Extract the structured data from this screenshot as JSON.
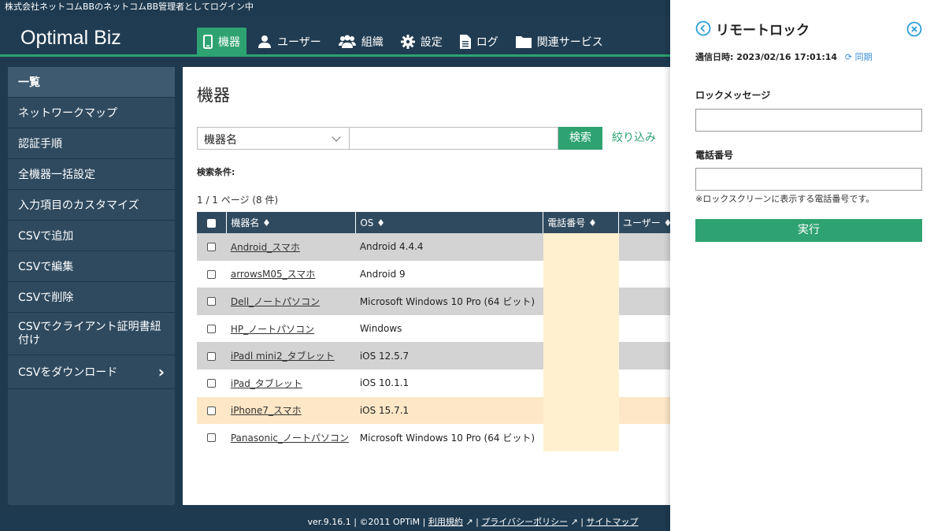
{
  "topbar": {
    "login_text": "株式会社ネットコムBBのネットコムBB管理者としてログイン中"
  },
  "header": {
    "logo": "Optimal Biz",
    "nav": [
      {
        "label": "機器",
        "icon": "device-icon",
        "active": true
      },
      {
        "label": "ユーザー",
        "icon": "user-icon"
      },
      {
        "label": "組織",
        "icon": "group-icon"
      },
      {
        "label": "設定",
        "icon": "gear-icon"
      },
      {
        "label": "ログ",
        "icon": "document-icon"
      },
      {
        "label": "関連サービス",
        "icon": "folder-icon"
      }
    ]
  },
  "sidebar": {
    "items": [
      {
        "label": "一覧",
        "active": true
      },
      {
        "label": "ネットワークマップ"
      },
      {
        "label": "認証手順"
      },
      {
        "label": "全機器一括設定"
      },
      {
        "label": "入力項目のカスタマイズ"
      },
      {
        "label": "CSVで追加"
      },
      {
        "label": "CSVで編集"
      },
      {
        "label": "CSVで削除"
      },
      {
        "label": "CSVでクライアント証明書紐付け"
      },
      {
        "label": "CSVをダウンロード",
        "chevron": "›"
      }
    ]
  },
  "main": {
    "title": "機器",
    "search": {
      "field_select": "機器名",
      "button": "検索",
      "filter_link": "絞り込み"
    },
    "conditions_label": "検索条件:",
    "page_info": "1 / 1 ページ (8 件)",
    "table": {
      "headers": [
        "機器名 ♦",
        "OS ♦",
        "電話番号 ♦",
        "ユーザー ♦"
      ],
      "rows": [
        {
          "name": "Android_スマホ",
          "os": "Android 4.4.4",
          "style": "gray"
        },
        {
          "name": "arrowsM05_スマホ",
          "os": "Android 9",
          "style": "white"
        },
        {
          "name": "Dell_ノートパソコン",
          "os": "Microsoft Windows 10 Pro (64 ビット)",
          "style": "gray"
        },
        {
          "name": "HP_ノートパソコン",
          "os": "Windows",
          "style": "white"
        },
        {
          "name": "iPadl mini2_タブレット",
          "os": "iOS 12.5.7",
          "style": "gray"
        },
        {
          "name": "iPad_タブレット",
          "os": "iOS 10.1.1",
          "style": "white"
        },
        {
          "name": "iPhone7_スマホ",
          "os": "iOS 15.7.1",
          "style": "highlight"
        },
        {
          "name": "Panasonic_ノートパソコン",
          "os": "Microsoft Windows 10 Pro (64 ビット)",
          "style": "white"
        }
      ]
    }
  },
  "footer": {
    "version": "ver.9.16.1 | ©2011 OPTiM | ",
    "terms": "利用規約",
    "privacy": "プライバシーポリシー",
    "sitemap": "サイトマップ",
    "sep": " | "
  },
  "panel": {
    "title": "リモートロック",
    "sync_label": "通信日時: 2023/02/16 17:01:14",
    "sync_link": "同期",
    "lock_message_label": "ロックメッセージ",
    "phone_label": "電話番号",
    "phone_note": "※ロックスクリーンに表示する電話番号です。",
    "execute_button": "実行"
  },
  "colors": {
    "accent": "#2ea371",
    "navy": "#203c52",
    "link_blue": "#3b8fd8"
  }
}
